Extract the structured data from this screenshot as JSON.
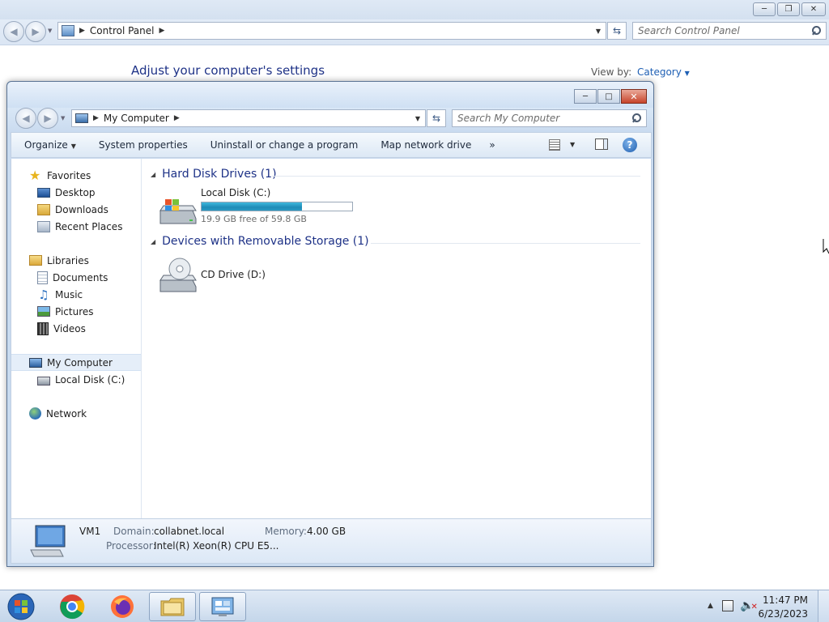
{
  "control_panel": {
    "address": {
      "segments": [
        "Control Panel"
      ]
    },
    "search_placeholder": "Search Control Panel",
    "heading": "Adjust your computer's settings",
    "view_by_label": "View by:",
    "view_by_value": "Category"
  },
  "my_computer": {
    "address": {
      "segments": [
        "My Computer"
      ]
    },
    "search_placeholder": "Search My Computer",
    "toolbar": {
      "organize": "Organize",
      "system_properties": "System properties",
      "uninstall": "Uninstall or change a program",
      "map_drive": "Map network drive",
      "more": "»"
    },
    "nav": {
      "favorites": "Favorites",
      "desktop": "Desktop",
      "downloads": "Downloads",
      "recent_places": "Recent Places",
      "libraries": "Libraries",
      "documents": "Documents",
      "music": "Music",
      "pictures": "Pictures",
      "videos": "Videos",
      "my_computer": "My Computer",
      "local_disk": "Local Disk (C:)",
      "network": "Network"
    },
    "groups": {
      "hard_disks": "Hard Disk Drives (1)",
      "removable": "Devices with Removable Storage (1)"
    },
    "drives": {
      "c_name": "Local Disk (C:)",
      "c_free": "19.9 GB free of 59.8 GB",
      "c_used_fraction": 0.667,
      "d_name": "CD Drive (D:)"
    },
    "details": {
      "computer_name": "VM1",
      "domain_label": "Domain:",
      "domain_value": "collabnet.local",
      "memory_label": "Memory:",
      "memory_value": "4.00 GB",
      "processor_label": "Processor:",
      "processor_value": "Intel(R) Xeon(R) CPU E5..."
    }
  },
  "taskbar": {
    "time": "11:47 PM",
    "date": "6/23/2023",
    "apps": [
      "chrome-icon",
      "firefox-icon",
      "explorer-icon",
      "control-panel-icon"
    ]
  }
}
